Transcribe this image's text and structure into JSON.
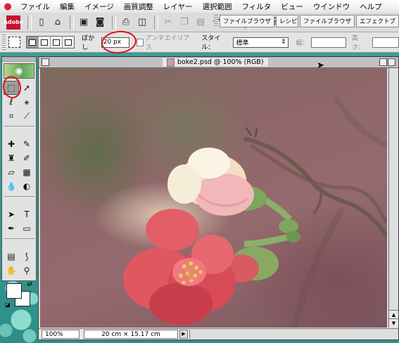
{
  "menubar": {
    "apple": "",
    "items": [
      "ファイル",
      "編集",
      "イメージ",
      "画質調整",
      "レイヤー",
      "選択範囲",
      "フィルタ",
      "ビュー",
      "ウインドウ",
      "ヘルプ"
    ]
  },
  "toolbar": {
    "logo_text": "Adobe",
    "palette_tabs": [
      "ファイルブラウザ",
      "レシピ",
      "ファイルブラウザ",
      "エフェクトブ"
    ]
  },
  "options": {
    "feather_label": "ぼかし",
    "feather_value": "20 px",
    "antialias_label": "アンチエイリアス",
    "style_label": "スタイル：",
    "style_value": "標準",
    "width_label": "幅：",
    "height_label": "高さ："
  },
  "document": {
    "title": "boke2.psd @ 100% (RGB)",
    "zoom": "100%",
    "doc_info": "20 cm × 15.17 cm"
  },
  "colors": {
    "annotation": "#e0121a",
    "desktop": "#3f9e98"
  }
}
